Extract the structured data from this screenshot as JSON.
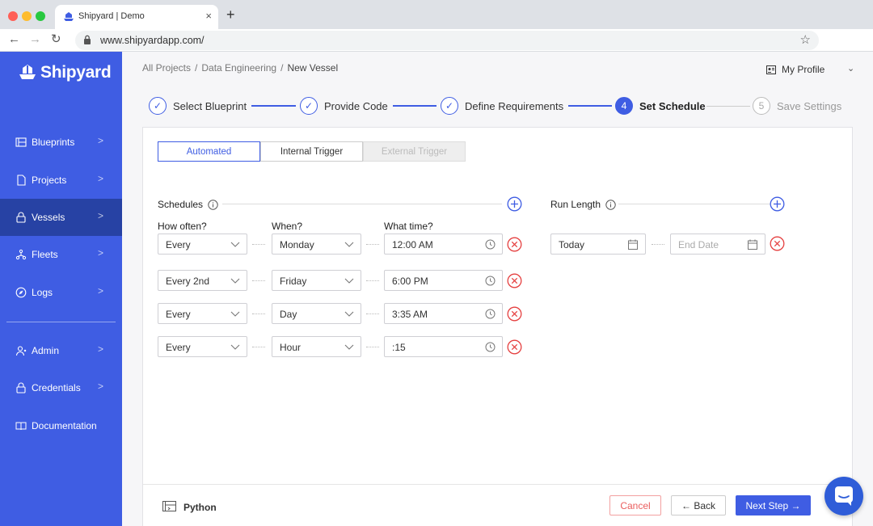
{
  "browser": {
    "tab_title": "Shipyard | Demo",
    "tab_close": "×",
    "new_tab": "+",
    "url": "www.shipyardapp.com/",
    "back": "←",
    "forward": "→",
    "reload": "↻",
    "star": "☆",
    "menu": "⋮"
  },
  "sidebar": {
    "logo": "Shipyard",
    "items": [
      {
        "label": "Blueprints",
        "icon": "blueprint-icon",
        "chevron": ">"
      },
      {
        "label": "Projects",
        "icon": "document-icon",
        "chevron": ">"
      },
      {
        "label": "Vessels",
        "icon": "lock-icon",
        "chevron": ">",
        "active": true
      },
      {
        "label": "Fleets",
        "icon": "fleet-icon",
        "chevron": ">"
      },
      {
        "label": "Logs",
        "icon": "compass-icon",
        "chevron": ">"
      },
      {
        "label": "Admin",
        "icon": "admin-icon",
        "chevron": ">"
      },
      {
        "label": "Credentials",
        "icon": "lock-icon",
        "chevron": ">"
      },
      {
        "label": "Documentation",
        "icon": "book-icon",
        "chevron": ""
      }
    ]
  },
  "header": {
    "breadcrumb": [
      "All Projects",
      "Data Engineering",
      "New Vessel"
    ],
    "separator": "/",
    "profile": "My Profile",
    "profile_chevron": "⌄"
  },
  "steps": [
    {
      "label": "Select Blueprint",
      "state": "done",
      "marker": "✓"
    },
    {
      "label": "Provide Code",
      "state": "done",
      "marker": "✓"
    },
    {
      "label": "Define Requirements",
      "state": "done",
      "marker": "✓"
    },
    {
      "label": "Set Schedule",
      "state": "current",
      "marker": "4"
    },
    {
      "label": "Save Settings",
      "state": "future",
      "marker": "5"
    }
  ],
  "trigger_tabs": [
    {
      "label": "Automated",
      "state": "active"
    },
    {
      "label": "Internal Trigger",
      "state": "normal"
    },
    {
      "label": "External Trigger",
      "state": "disabled"
    }
  ],
  "schedules": {
    "title": "Schedules",
    "columns": [
      "How often?",
      "When?",
      "What time?"
    ],
    "rows": [
      {
        "how_often": "Every",
        "when": "Monday",
        "time": "12:00 AM"
      },
      {
        "how_often": "Every 2nd",
        "when": "Friday",
        "time": "6:00 PM"
      },
      {
        "how_often": "Every",
        "when": "Day",
        "time": "3:35 AM"
      },
      {
        "how_often": "Every",
        "when": "Hour",
        "time": ":15"
      }
    ]
  },
  "run_length": {
    "title": "Run Length",
    "start": "Today",
    "end_placeholder": "End Date"
  },
  "footer": {
    "language": "Python",
    "cancel": "Cancel",
    "back": "← Back",
    "next": "Next Step →"
  },
  "colors": {
    "brand": "#3f5de3",
    "sidebar_active": "#2742a4",
    "danger": "#ea5d5d"
  }
}
